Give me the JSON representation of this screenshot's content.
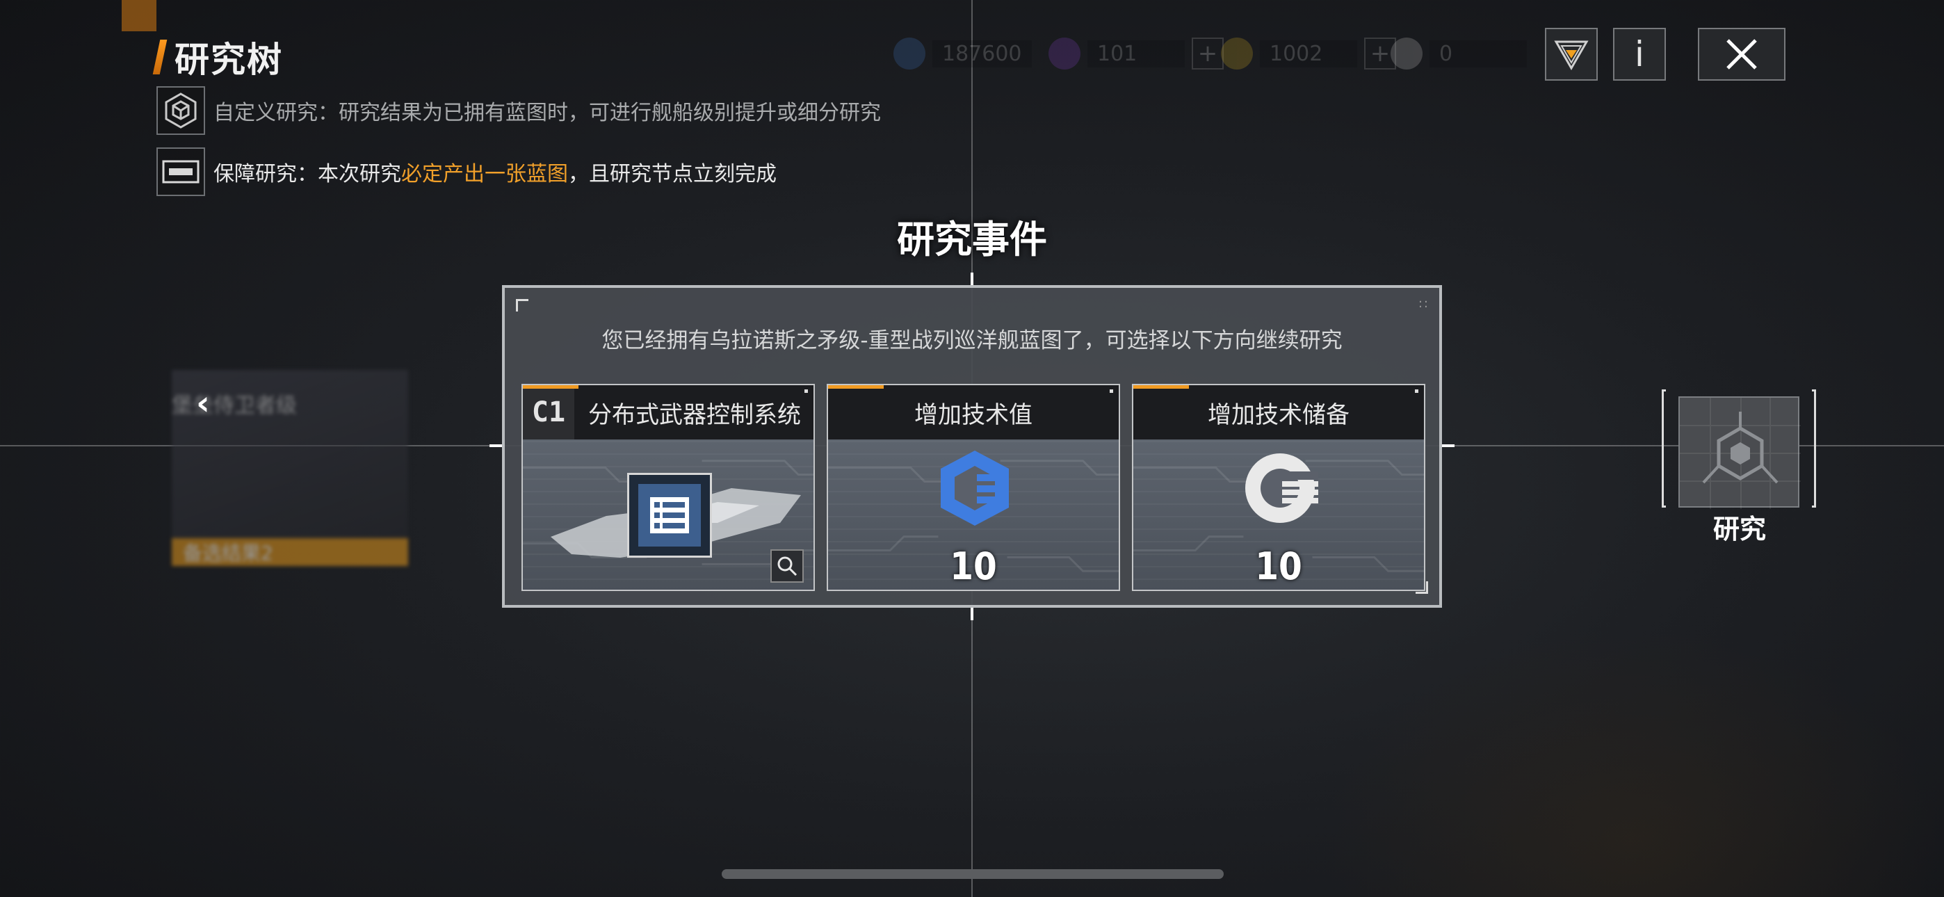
{
  "header": {
    "title": "研究树"
  },
  "info": {
    "custom_research": "自定义研究：研究结果为已拥有蓝图时，可进行舰船级别提升或细分研究",
    "guaranteed_prefix": "保障研究：本次研究",
    "guaranteed_highlight": "必定产出一张蓝图",
    "guaranteed_suffix": "，且研究节点立刻完成"
  },
  "resources": [
    {
      "icon": "tech-value-icon",
      "value": "187600"
    },
    {
      "icon": "purple-crystal-icon",
      "value": "101"
    },
    {
      "icon": "gold-coin-icon",
      "value": "1002"
    },
    {
      "icon": "tech-reserve-icon",
      "value": "0"
    }
  ],
  "event": {
    "title": "研究事件",
    "description": "您已经拥有乌拉诺斯之矛级-重型战列巡洋舰蓝图了，可选择以下方向继续研究",
    "options": [
      {
        "badge": "C1",
        "label": "分布式武器控制系统",
        "icon": "blueprint-list-icon"
      },
      {
        "label": "增加技术值",
        "value": "10",
        "icon": "tech-value-icon"
      },
      {
        "label": "增加技术储备",
        "value": "10",
        "icon": "tech-reserve-icon"
      }
    ]
  },
  "right_node": {
    "label": "研究"
  },
  "left_node": {
    "title": "堡垒侍卫者级",
    "tag": "备选结果2"
  },
  "colors": {
    "accent": "#f09a22",
    "highlight_text": "#f1a02a",
    "tech_blue": "#3f7de0"
  }
}
